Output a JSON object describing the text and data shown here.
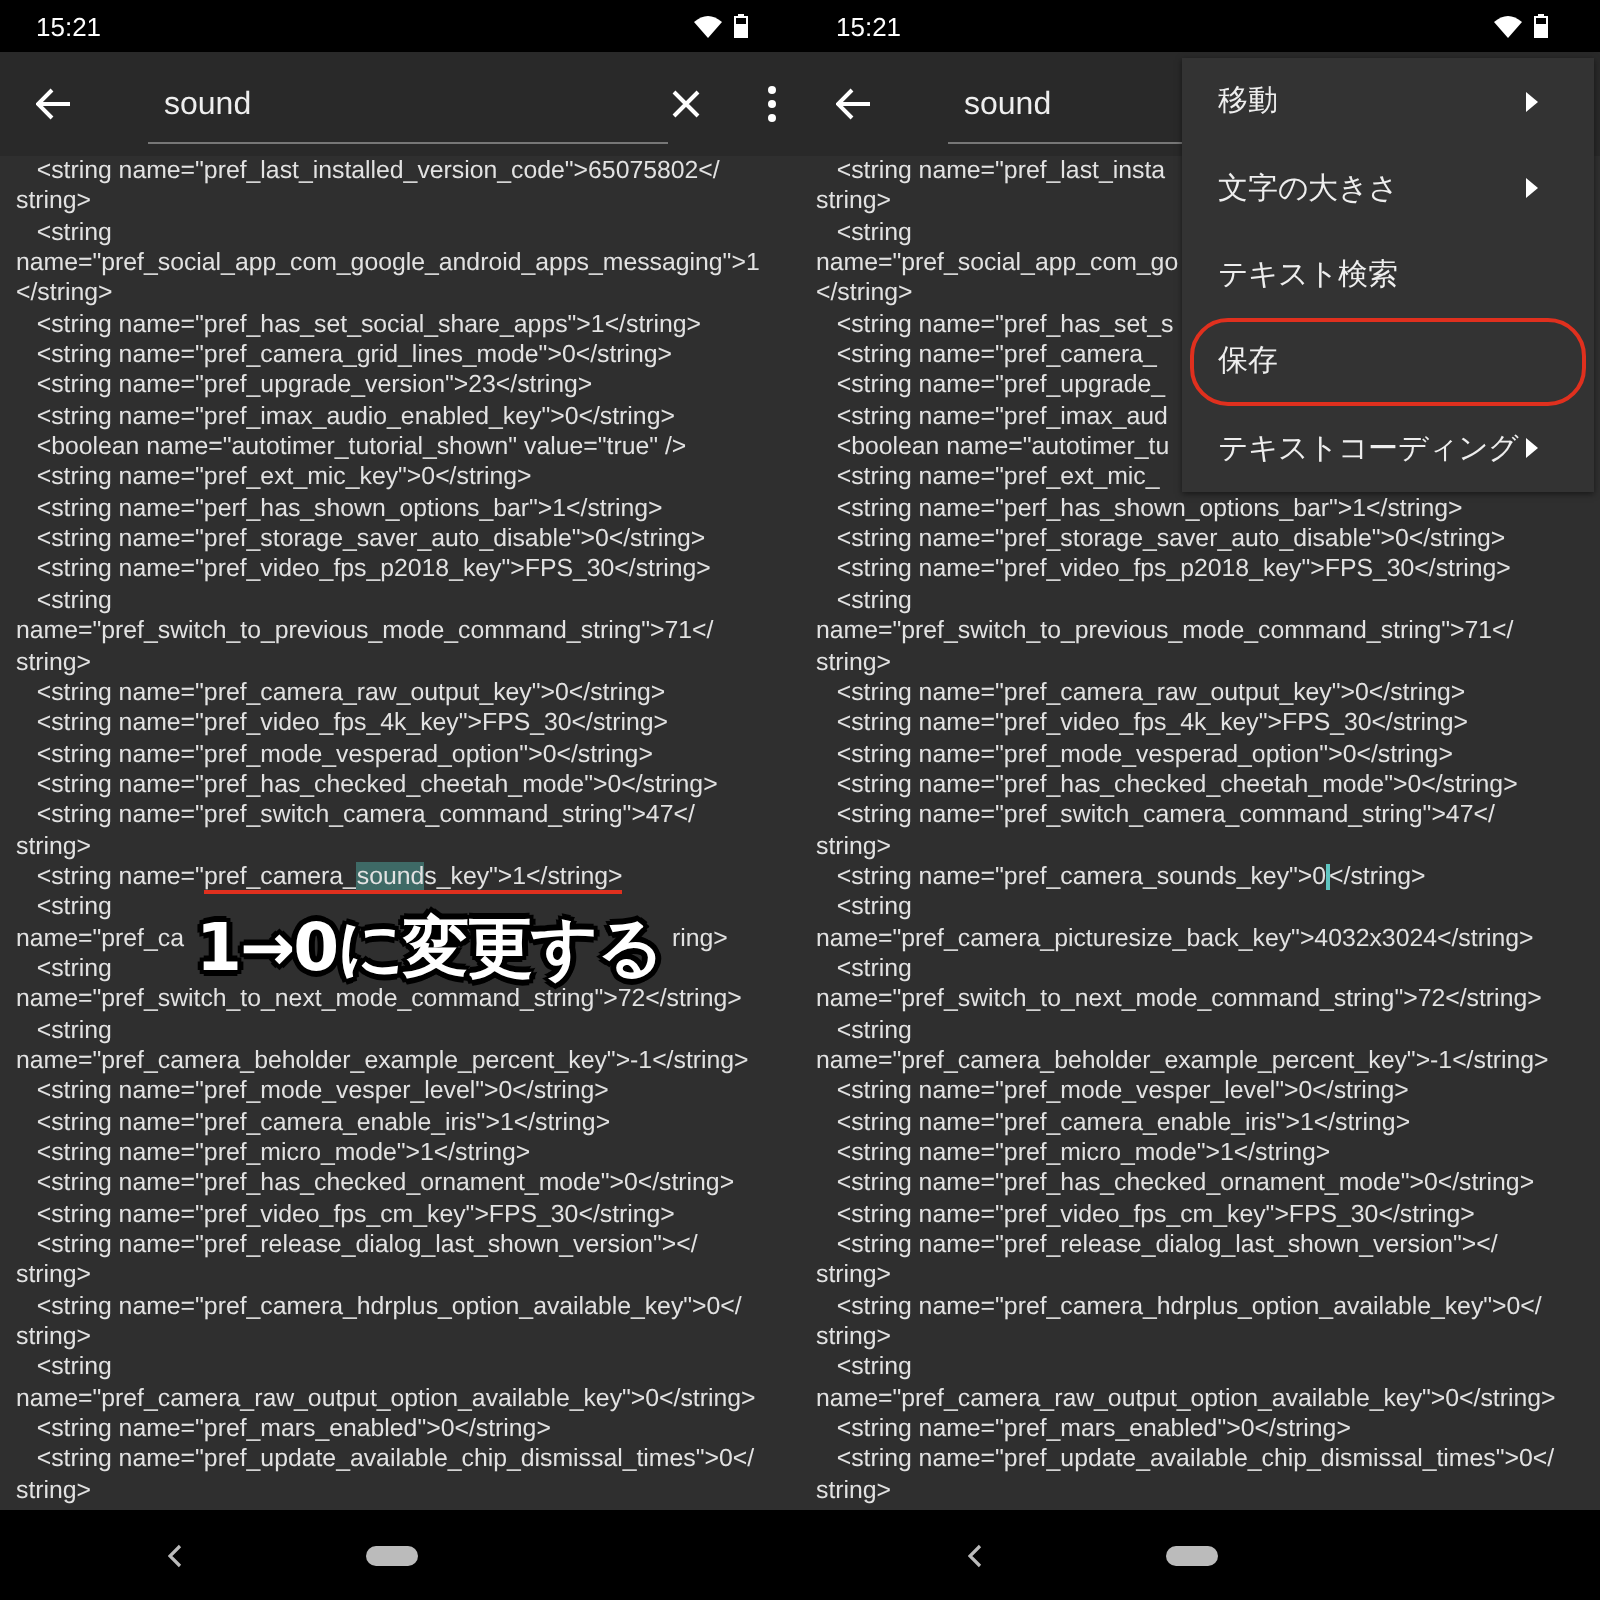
{
  "panels": [
    {
      "status_bar": {
        "time": "15:21"
      },
      "toolbar": {
        "query": "sound",
        "actions_visible": true
      },
      "lines": [
        {
          "text": "   <string name=\"pref_last_installed_version_code\">65075802</"
        },
        {
          "text": "string>"
        },
        {
          "text": "   <string"
        },
        {
          "text": "name=\"pref_social_app_com_google_android_apps_messaging\">1"
        },
        {
          "text": "</string>"
        },
        {
          "text": "   <string name=\"pref_has_set_social_share_apps\">1</string>"
        },
        {
          "text": "   <string name=\"pref_camera_grid_lines_mode\">0</string>"
        },
        {
          "text": "   <string name=\"pref_upgrade_version\">23</string>"
        },
        {
          "text": "   <string name=\"pref_imax_audio_enabled_key\">0</string>"
        },
        {
          "text": "   <boolean name=\"autotimer_tutorial_shown\" value=\"true\" />"
        },
        {
          "text": "   <string name=\"pref_ext_mic_key\">0</string>"
        },
        {
          "text": "   <string name=\"perf_has_shown_options_bar\">1</string>"
        },
        {
          "text": "   <string name=\"pref_storage_saver_auto_disable\">0</string>"
        },
        {
          "text": "   <string name=\"pref_video_fps_p2018_key\">FPS_30</string>"
        },
        {
          "text": "   <string"
        },
        {
          "text": "name=\"pref_switch_to_previous_mode_command_string\">71</"
        },
        {
          "text": "string>"
        },
        {
          "text": "   <string name=\"pref_camera_raw_output_key\">0</string>"
        },
        {
          "text": "   <string name=\"pref_video_fps_4k_key\">FPS_30</string>"
        },
        {
          "text": "   <string name=\"pref_mode_vesperad_option\">0</string>"
        },
        {
          "text": "   <string name=\"pref_has_checked_cheetah_mode\">0</string>"
        },
        {
          "text": "   <string name=\"pref_switch_camera_command_string\">47</"
        },
        {
          "text": "string>"
        },
        {
          "segments": [
            {
              "text": "   <string name=\"",
              "highlighted": false,
              "underlined": false
            },
            {
              "text": "pref_camera_",
              "highlighted": false,
              "underlined": true
            },
            {
              "text": "sound",
              "highlighted": true,
              "underlined": true
            },
            {
              "text": "s_key\">1</string>",
              "highlighted": false,
              "underlined": true
            }
          ]
        },
        {
          "text": "   <string"
        },
        {
          "segments": [
            {
              "text": "name=\"pref_ca",
              "highlighted": false,
              "underlined": false
            },
            {
              "text": "ring>",
              "highlighted": false,
              "underlined": false,
              "after_overlay": true
            }
          ]
        },
        {
          "text": "   <string"
        },
        {
          "text": "name=\"pref_switch_to_next_mode_command_string\">72</string>"
        },
        {
          "text": "   <string"
        },
        {
          "text": "name=\"pref_camera_beholder_example_percent_key\">-1</string>"
        },
        {
          "text": "   <string name=\"pref_mode_vesper_level\">0</string>"
        },
        {
          "text": "   <string name=\"pref_camera_enable_iris\">1</string>"
        },
        {
          "text": "   <string name=\"pref_micro_mode\">1</string>"
        },
        {
          "text": "   <string name=\"pref_has_checked_ornament_mode\">0</string>"
        },
        {
          "text": "   <string name=\"pref_video_fps_cm_key\">FPS_30</string>"
        },
        {
          "text": "   <string name=\"pref_release_dialog_last_shown_version\"></"
        },
        {
          "text": "string>"
        },
        {
          "text": "   <string name=\"pref_camera_hdrplus_option_available_key\">0</"
        },
        {
          "text": "string>"
        },
        {
          "text": "   <string"
        },
        {
          "text": "name=\"pref_camera_raw_output_option_available_key\">0</string>"
        },
        {
          "text": "   <string name=\"pref_mars_enabled\">0</string>"
        },
        {
          "text": "   <string name=\"pref_update_available_chip_dismissal_times\">0</"
        },
        {
          "text": "string>"
        }
      ],
      "caption": "1→0に変更する"
    },
    {
      "status_bar": {
        "time": "15:21"
      },
      "toolbar": {
        "query": "sound"
      },
      "lines": [
        {
          "text": "   <string name=\"pref_last_insta"
        },
        {
          "text": "string>"
        },
        {
          "text": "   <string"
        },
        {
          "text": "name=\"pref_social_app_com_go"
        },
        {
          "text": "</string>"
        },
        {
          "text": "   <string name=\"pref_has_set_s"
        },
        {
          "text": "   <string name=\"pref_camera_"
        },
        {
          "text": "   <string name=\"pref_upgrade_"
        },
        {
          "text": "   <string name=\"pref_imax_aud"
        },
        {
          "text": "   <boolean name=\"autotimer_tu"
        },
        {
          "text": "   <string name=\"pref_ext_mic_"
        },
        {
          "text": "   <string name=\"perf_has_shown_options_bar\">1</string>"
        },
        {
          "text": "   <string name=\"pref_storage_saver_auto_disable\">0</string>"
        },
        {
          "text": "   <string name=\"pref_video_fps_p2018_key\">FPS_30</string>"
        },
        {
          "text": "   <string"
        },
        {
          "text": "name=\"pref_switch_to_previous_mode_command_string\">71</"
        },
        {
          "text": "string>"
        },
        {
          "text": "   <string name=\"pref_camera_raw_output_key\">0</string>"
        },
        {
          "text": "   <string name=\"pref_video_fps_4k_key\">FPS_30</string>"
        },
        {
          "text": "   <string name=\"pref_mode_vesperad_option\">0</string>"
        },
        {
          "text": "   <string name=\"pref_has_checked_cheetah_mode\">0</string>"
        },
        {
          "text": "   <string name=\"pref_switch_camera_command_string\">47</"
        },
        {
          "text": "string>"
        },
        {
          "segments": [
            {
              "text": "   <string name=\"pref_camera_sounds_key\">0",
              "highlighted": false,
              "underlined": false,
              "caret": true
            },
            {
              "text": "</string>",
              "highlighted": false,
              "underlined": false
            }
          ]
        },
        {
          "text": "   <string"
        },
        {
          "text": "name=\"pref_camera_picturesize_back_key\">4032x3024</string>"
        },
        {
          "text": "   <string"
        },
        {
          "text": "name=\"pref_switch_to_next_mode_command_string\">72</string>"
        },
        {
          "text": "   <string"
        },
        {
          "text": "name=\"pref_camera_beholder_example_percent_key\">-1</string>"
        },
        {
          "text": "   <string name=\"pref_mode_vesper_level\">0</string>"
        },
        {
          "text": "   <string name=\"pref_camera_enable_iris\">1</string>"
        },
        {
          "text": "   <string name=\"pref_micro_mode\">1</string>"
        },
        {
          "text": "   <string name=\"pref_has_checked_ornament_mode\">0</string>"
        },
        {
          "text": "   <string name=\"pref_video_fps_cm_key\">FPS_30</string>"
        },
        {
          "text": "   <string name=\"pref_release_dialog_last_shown_version\"></"
        },
        {
          "text": "string>"
        },
        {
          "text": "   <string name=\"pref_camera_hdrplus_option_available_key\">0</"
        },
        {
          "text": "string>"
        },
        {
          "text": "   <string"
        },
        {
          "text": "name=\"pref_camera_raw_output_option_available_key\">0</string>"
        },
        {
          "text": "   <string name=\"pref_mars_enabled\">0</string>"
        },
        {
          "text": "   <string name=\"pref_update_available_chip_dismissal_times\">0</"
        },
        {
          "text": "string>"
        }
      ],
      "menu": {
        "items": [
          {
            "label": "移動",
            "submenu": true,
            "circled": false
          },
          {
            "label": "文字の大きさ",
            "submenu": true,
            "circled": false
          },
          {
            "label": "テキスト検索",
            "submenu": false,
            "circled": false
          },
          {
            "label": "保存",
            "submenu": false,
            "circled": true
          },
          {
            "label": "テキストコーディング",
            "submenu": true,
            "circled": false
          }
        ]
      }
    }
  ]
}
